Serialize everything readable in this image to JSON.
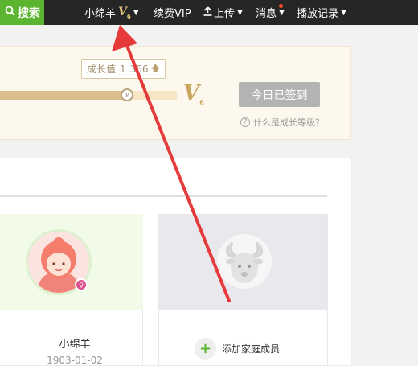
{
  "topbar": {
    "search_label": "搜索",
    "username": "小绵羊",
    "vip_level_badge": "V",
    "vip_level_num": "6",
    "renew_vip": "续费VIP",
    "upload": "上传",
    "messages": "消息",
    "history": "播放记录"
  },
  "growth": {
    "tip_label": "成长值",
    "tip_value": "1",
    "tip_value_tail": "366",
    "progress": 0.72,
    "next_level_badge": "V",
    "next_level_num": "6",
    "signed_in_label": "今日已签到",
    "what_is_level": "什么是成长等级？"
  },
  "family": {
    "member": {
      "name": "小绵羊",
      "birthday": "1903-01-02"
    },
    "add_member_label": "添加家庭成员"
  },
  "colors": {
    "topbar_bg": "#262626",
    "search_green": "#5cb531",
    "annotation_arrow": "#e5393a",
    "gold": "#c8a75c"
  }
}
